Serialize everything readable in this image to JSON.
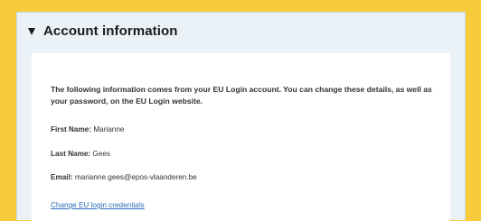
{
  "section": {
    "title": "Account information",
    "intro": "The following information comes from your EU Login account. You can change these details, as well as your password, on the EU Login website.",
    "fields": [
      {
        "label": "First Name:",
        "value": "Marianne"
      },
      {
        "label": "Last Name:",
        "value": "Gees"
      },
      {
        "label": "Email:",
        "value": "marianne.gees@epos-vlaanderen.be"
      }
    ],
    "link_label": "Change EU login credentials",
    "toggle_icon": "triangle-down-icon"
  },
  "colors": {
    "background": "#f7cb3a",
    "panel": "#eaf2f8",
    "card": "#ffffff",
    "link": "#2a6fb5"
  }
}
